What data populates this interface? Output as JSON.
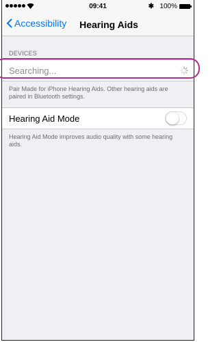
{
  "status_bar": {
    "time": "09:41",
    "battery_percent": "100%",
    "bluetooth_icon": "bluetooth-icon",
    "wifi_icon": "wifi-icon"
  },
  "nav": {
    "back_label": "Accessibility",
    "title": "Hearing Aids"
  },
  "devices": {
    "header": "DEVICES",
    "searching_text": "Searching...",
    "footer": "Pair Made for iPhone Hearing Aids. Other hearing aids are paired in Bluetooth settings."
  },
  "hearing_aid_mode": {
    "label": "Hearing Aid Mode",
    "enabled": false,
    "footer": "Hearing Aid Mode improves audio quality with some hearing aids."
  },
  "colors": {
    "accent": "#007aff",
    "highlight": "#b32b8f",
    "background": "#efeff4"
  }
}
